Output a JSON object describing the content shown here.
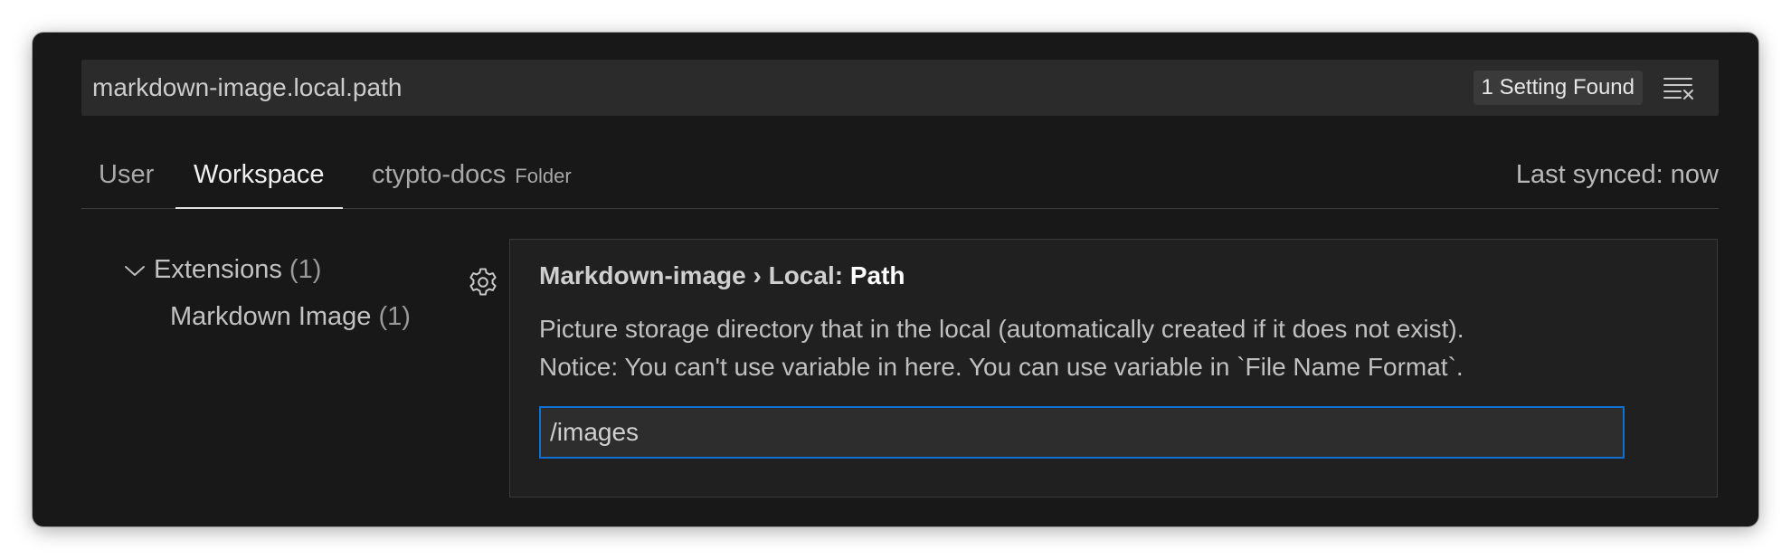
{
  "search": {
    "value": "markdown-image.local.path",
    "result_count": "1 Setting Found",
    "clear_icon": "clear-filter-icon"
  },
  "tabs": [
    {
      "label": "User",
      "active": false
    },
    {
      "label": "Workspace",
      "active": true
    },
    {
      "label": "ctypto-docs",
      "hint": "Folder",
      "active": false
    }
  ],
  "sync_status": "Last synced: now",
  "toc": {
    "group": {
      "label": "Extensions",
      "count": "(1)",
      "icon": "chevron-down-icon"
    },
    "child": {
      "label": "Markdown Image",
      "count": "(1)"
    }
  },
  "setting": {
    "gear_icon": "gear-icon",
    "title_prefix": "Markdown-image › Local: ",
    "title_name": "Path",
    "description_line1": "Picture storage directory that in the local (automatically created if it does not exist).",
    "description_line2": "Notice: You can't use variable in here. You can use variable in `File Name Format`.",
    "value": "/images"
  },
  "colors": {
    "background": "#181818",
    "panel": "#202020",
    "input_focus_border": "#0f6fd2",
    "text": "#cccccc"
  }
}
